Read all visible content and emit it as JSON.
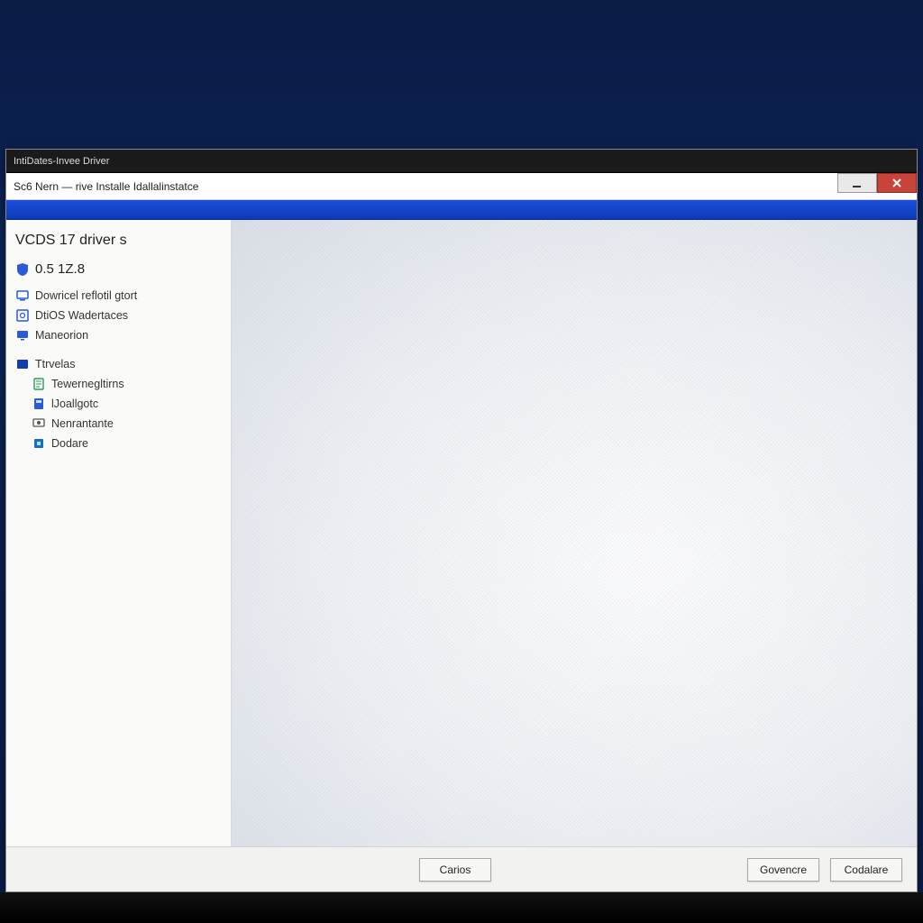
{
  "window": {
    "outer_title": "IntiDates-Invee Driver",
    "inner_title": "Sc6 Nern — rive Installe Idallalinstatce"
  },
  "sidebar": {
    "heading": "VCDS 17 driver s",
    "version": "0.5 1Z.8",
    "items": [
      {
        "icon": "device-icon",
        "label": "Dowricel reflotil gtort"
      },
      {
        "icon": "disk-icon",
        "label": "DtiOS Wadertaces"
      },
      {
        "icon": "monitor-icon",
        "label": "Maneorion"
      }
    ],
    "subheading": "Ttrvelas",
    "subitems": [
      {
        "icon": "page-icon",
        "label": "Tewernegltirns"
      },
      {
        "icon": "calc-icon",
        "label": "lJoallgotc"
      },
      {
        "icon": "net-icon",
        "label": "Nenrantante"
      },
      {
        "icon": "chip-icon",
        "label": "Dodare"
      }
    ]
  },
  "footer": {
    "left_button": "Carios",
    "mid_button": "Govencre",
    "right_button": "Codalare"
  },
  "colors": {
    "accent": "#1b4fdc",
    "close": "#c8443a"
  }
}
